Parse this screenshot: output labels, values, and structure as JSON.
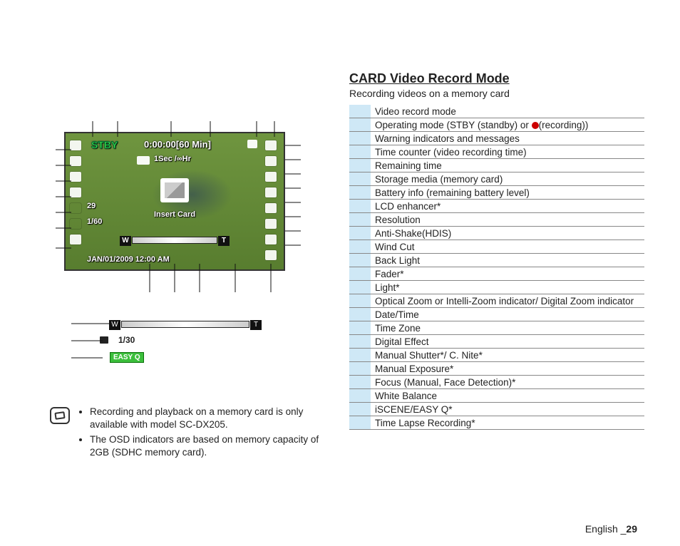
{
  "section": {
    "title": "CARD Video Record Mode",
    "subtitle": "Recording videos on a memory card"
  },
  "table": {
    "rows": [
      {
        "num": "",
        "desc": "Video record mode"
      },
      {
        "num": "",
        "desc_prefix": "Operating mode (STBY (standby) or ",
        "desc_suffix": "(recording))"
      },
      {
        "num": "",
        "desc": "Warning indicators and messages"
      },
      {
        "num": "",
        "desc": "Time counter (video recording time)"
      },
      {
        "num": "",
        "desc": "Remaining time"
      },
      {
        "num": "",
        "desc": "Storage media (memory card)"
      },
      {
        "num": "",
        "desc": "Battery info (remaining battery level)"
      },
      {
        "num": "",
        "desc": "LCD enhancer*"
      },
      {
        "num": "",
        "desc": "Resolution"
      },
      {
        "num": "",
        "desc": "Anti-Shake(HDIS)"
      },
      {
        "num": "",
        "desc": "Wind Cut"
      },
      {
        "num": "",
        "desc": "Back Light"
      },
      {
        "num": "",
        "desc": "Fader*"
      },
      {
        "num": "",
        "desc": "Light*"
      },
      {
        "num": "",
        "desc": "Optical Zoom or Intelli-Zoom indicator/ Digital Zoom indicator"
      },
      {
        "num": "",
        "desc": "Date/Time"
      },
      {
        "num": "",
        "desc": "Time Zone"
      },
      {
        "num": "",
        "desc": "Digital Effect"
      },
      {
        "num": "",
        "desc": "Manual Shutter*/ C. Nite*"
      },
      {
        "num": "",
        "desc": "Manual Exposure*"
      },
      {
        "num": "",
        "desc": "Focus (Manual, Face Detection)*"
      },
      {
        "num": "",
        "desc": "White Balance"
      },
      {
        "num": "",
        "desc": "iSCENE/EASY Q*"
      },
      {
        "num": "",
        "desc": "Time Lapse Recording*"
      }
    ]
  },
  "lcd": {
    "stby": "STBY",
    "time_counter": "0:00:00",
    "remaining": "[60 Min]",
    "interval": "1Sec /∞Hr",
    "exposure": "29",
    "shutter": "1/60",
    "insert_card": "Insert Card",
    "datetime": "JAN/01/2009 12:00 AM",
    "zoom_w": "W",
    "zoom_t": "T"
  },
  "lcd2": {
    "zoom_w": "W",
    "zoom_t": "T",
    "shutter": "1/30",
    "easyq": "EASY Q"
  },
  "notes": {
    "items": [
      "Recording and playback on a memory card is only available with model SC-DX205.",
      "The OSD indicators are based on memory capacity of 2GB (SDHC memory card)."
    ]
  },
  "footer": {
    "lang": "English _",
    "page": "29"
  }
}
